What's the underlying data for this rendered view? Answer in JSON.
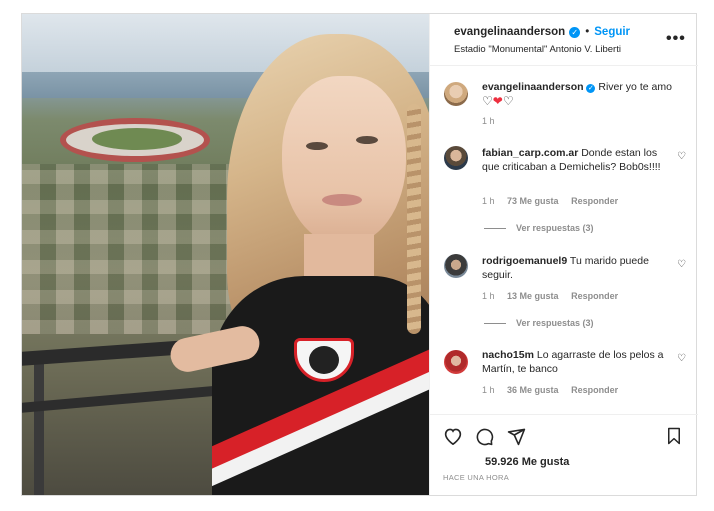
{
  "post": {
    "username": "evangelinaanderson",
    "verified_badge": "✓",
    "separator": "•",
    "follow_label": "Seguir",
    "location": "Estadio \"Monumental\" Antonio V. Liberti",
    "more_icon": "more-horizontal-icon",
    "more_glyph": "•••"
  },
  "caption": {
    "username": "evangelinaanderson",
    "text": "River yo te amo",
    "hearts": [
      "♡",
      "❤",
      "♡"
    ],
    "time": "1 h"
  },
  "comments": [
    {
      "username": "fabian_carp.com.ar",
      "text": "Donde estan los que criticaban a Demichelis? Bob0s!!!!",
      "time": "1 h",
      "likes": "73 Me gusta",
      "reply": "Responder",
      "view_replies": "Ver respuestas (3)"
    },
    {
      "username": "rodrigoemanuel9",
      "text": "Tu marido puede seguir.",
      "time": "1 h",
      "likes": "13 Me gusta",
      "reply": "Responder",
      "view_replies": "Ver respuestas (3)"
    },
    {
      "username": "nacho15m",
      "text": "Lo agarraste de los pelos a Martín, te banco",
      "time": "1 h",
      "likes": "36 Me gusta",
      "reply": "Responder"
    }
  ],
  "footer": {
    "likes_total": "59.926 Me gusta",
    "time_ago": "HACE UNA HORA",
    "icons": [
      "heart-icon",
      "comment-icon",
      "share-icon",
      "bookmark-icon"
    ]
  },
  "colors": {
    "accent": "#0095f6",
    "red_heart": "#ed2f3f",
    "muted_text": "#8e8e8e",
    "border": "#dbdbdb"
  }
}
